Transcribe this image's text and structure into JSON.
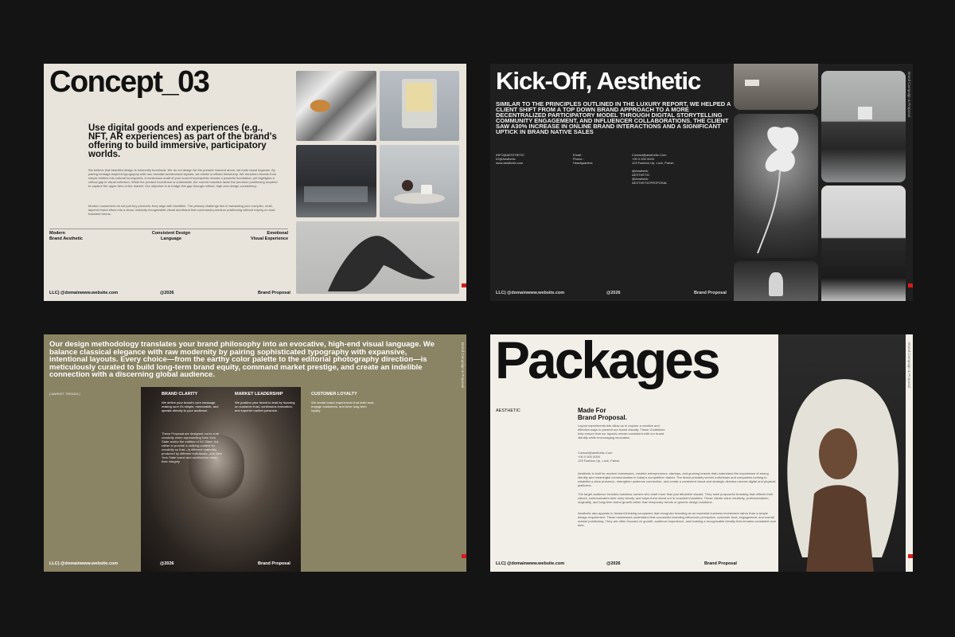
{
  "footer": {
    "domain": "LLC) @domainwww.website.com",
    "year": "@2026",
    "doc": "Brand Proposal"
  },
  "vertical_label": "Brand Campaign & Proposal",
  "slide1": {
    "title": "Concept_03",
    "lead": "Use digital goods and experiences (e.g., NFT, AR experiences) as part of the brand's offering to build immersive, participatory worlds.",
    "para1": "We believe that beautiful design is inherently functional. We do not design for the present moment alone; we build visual legacies. By pairing heritage-inspired typography with raw, brutalist architectural layouts, we create a refined dichotomy. We transform brands from simple entities into cultural touchpoints. A meticulous audit of your current touchpoints reveals a powerful foundation, yet highlights a critical gap in visual cohesion. While the product excellence is undeniable, the current narrative lacks the premium positioning required to capture the upper tiers of the market. Our objective is to bridge this gap through refined, high-end design consistency.",
    "para2": "Modern consumers do not just buy products; they align with identities. The primary challenge lies in translating your complex, multi-layered brand ethos into a clean, instantly recognizable visual shorthand that commands premium positioning without relying on loud, transient trends.",
    "labels": [
      {
        "line1": "Modern",
        "line2": "Brand Aesthetic"
      },
      {
        "line1": "Consistent Design",
        "line2": "Language"
      },
      {
        "line1": "Emotional",
        "line2": "Visual Experience"
      }
    ]
  },
  "slide2": {
    "title": "Kick-Off, Aesthetic",
    "lead": "Similar to the principles outlined in the luxury report, we helped a client shift from a top down brand approach to a more decentralized participatory model through digital storytelling community engagement, and influencer collaborations. The client saw a30% increase in online brand interactions and a significant uptick in brand native sales",
    "info_col1": [
      "INFO@AESTHETIC",
      "IG@Aesthetic",
      "www.aesthetic.com"
    ],
    "info_col2": [
      "Email :",
      "Phone :",
      "Headquarters:"
    ],
    "info_col3": [
      "Contact@aesthetic.Com",
      "+00 0 000 0000",
      "123 Fashion Up, Lock, Parish",
      "",
      "@Aesthetic",
      "AESTHETIC",
      "@Aesthetic",
      "AESTHETICPROPOSAL"
    ]
  },
  "slide3": {
    "lead": "Our design methodology translates your brand philosophy into an evocative, high-end visual language. We balance classical elegance with raw modernity by pairing sophisticated typography with expansive, intentional layouts. Every choice—from the earthy color palette to the editorial photography direction—is meticulously curated to build long-term brand equity, command market prestige, and create an indelible connection with a discerning global audience.",
    "tag": "[ MARKET TRENDS ]",
    "columns": [
      {
        "title": "BRAND CLARITY",
        "body": "We define your brand's core message, making sure it's simple, memorable, and speaks directly to your audience."
      },
      {
        "title": "MARKET LEADERSHIP",
        "body": "We position your brand to lead by focusing on customer trust, continuous innovation, and superior market presence."
      },
      {
        "title": "CUSTOMER LOYALTY",
        "body": "We create brand experiences that build trust, engage customers, and drive long-term loyalty."
      }
    ],
    "note": "These Proposal are designed not to curb creativity when representing New York State and/or the entities of NY State, but rather to provide a unifying context for creativity so that—in different materials produced by different individuals—the New York State brand and architecture retain their integrity"
  },
  "slide4": {
    "title": "Packages",
    "tag": "AESTHETIC",
    "made_for1": "Made For",
    "made_for2": "Brand Proposal.",
    "intro": "Layout experiments lets allow us to explore a creative and effective ways to present our brand visually. These Guidelines help ensure that our layouts remain consistent with our brand identity while encouraging innovation.",
    "contact": [
      "Contact@aesthetic.Com",
      "+00 0 000 0000",
      "125 Fashion Up, Lock, Parish"
    ],
    "para1": "Aesthetic is built for modern businesses, creative entrepreneurs, startups, and growing brands that understand the importance of strong identity and meaningful communication in today's competitive market. The brand primarily serves individuals and companies looking to establish a clear presence, strengthen audience connection, and create a consistent visual and strategic direction across digital and physical platforms.",
    "para2": "The target audience includes business owners who want more than just attractive visuals. They seek purposeful branding that reflects their values, communicates their story clearly, and helps them stand out in crowded industries. These clients value creativity, professionalism, originality, and long-term brand growth rather than temporary trends or generic design solutions.",
    "para3": "Aesthetic also appeals to forward-thinking companies that recognize branding as an essential business investment rather than a simple design requirement. These businesses understand that successful branding influences perception, customer trust, engagement, and overall market positioning. They are often focused on growth, audience experience, and building a recognizable identity that remains consistent over time."
  }
}
